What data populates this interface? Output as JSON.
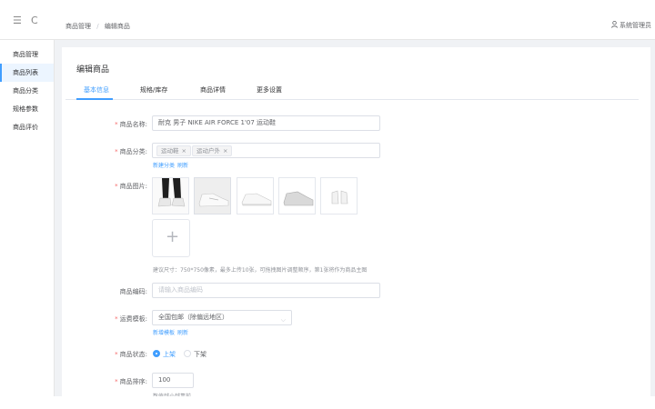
{
  "header": {
    "breadcrumb": [
      "商品管理",
      "编辑商品"
    ],
    "user_name": "系统管理员"
  },
  "sidebar": {
    "items": [
      {
        "label": "商品管理"
      },
      {
        "label": "商品列表"
      },
      {
        "label": "商品分类"
      },
      {
        "label": "规格参数"
      },
      {
        "label": "商品评价"
      }
    ]
  },
  "page": {
    "title": "编辑商品",
    "tabs": [
      "基本信息",
      "规格/库存",
      "商品详情",
      "更多设置"
    ]
  },
  "form": {
    "name_label": "商品名称:",
    "name_value": "耐克 男子 NIKE AIR FORCE 1'07 运动鞋",
    "category_label": "商品分类:",
    "category_tags": [
      "运动鞋",
      "运动户外"
    ],
    "category_links": [
      "新建分类",
      "刷新"
    ],
    "images_label": "商品图片:",
    "images_hint": "建议尺寸：750*750像素，最多上传10张，可拖拽图片调整顺序，第1张将作为商品主图",
    "code_label": "商品编码:",
    "code_placeholder": "请输入商品编码",
    "shipping_label": "运费模板:",
    "shipping_value": "全国包邮（除偏远地区）",
    "shipping_links": [
      "新增模板",
      "刷新"
    ],
    "status_label": "商品状态:",
    "status_options": [
      "上架",
      "下架"
    ],
    "sort_label": "商品排序:",
    "sort_value": "100",
    "sort_hint": "数值越小越靠前"
  },
  "colors": {
    "primary": "#409eff",
    "required": "#f56c6c"
  }
}
